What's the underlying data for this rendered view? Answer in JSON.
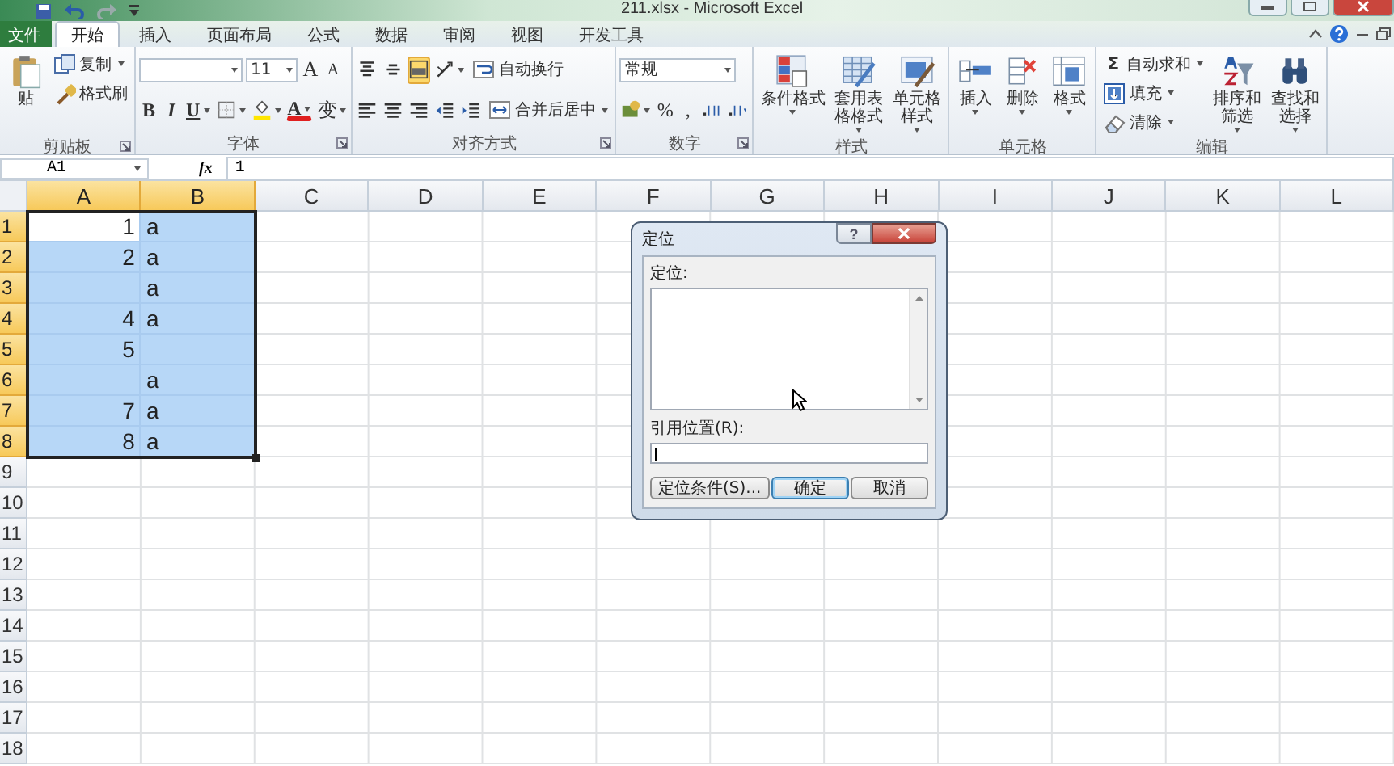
{
  "window": {
    "title": "211.xlsx - Microsoft Excel"
  },
  "tabs": [
    {
      "label": "文件",
      "kind": "file",
      "selected": false
    },
    {
      "label": "开始",
      "kind": "tab",
      "selected": true
    },
    {
      "label": "插入",
      "kind": "tab",
      "selected": false
    },
    {
      "label": "页面布局",
      "kind": "tab",
      "selected": false
    },
    {
      "label": "公式",
      "kind": "tab",
      "selected": false
    },
    {
      "label": "数据",
      "kind": "tab",
      "selected": false
    },
    {
      "label": "审阅",
      "kind": "tab",
      "selected": false
    },
    {
      "label": "视图",
      "kind": "tab",
      "selected": false
    },
    {
      "label": "开发工具",
      "kind": "tab",
      "selected": false
    }
  ],
  "ribbon": [
    {
      "label": "剪贴板",
      "launcher": true,
      "items": [
        {
          "kind": "large",
          "label": "贴",
          "dropdown": false
        },
        {
          "kind": "small",
          "label": "复制",
          "dropdown": true
        },
        {
          "kind": "small",
          "label": "格式刷",
          "dropdown": false
        }
      ]
    },
    {
      "label": "字体",
      "launcher": true,
      "items": [
        {
          "kind": "toolrow",
          "tools": [
            {
              "kind": "font-combo"
            },
            {
              "kind": "size-combo",
              "value": "11"
            },
            {
              "kind": "grow",
              "label": "A"
            },
            {
              "kind": "shrink",
              "label": "A"
            }
          ]
        },
        {
          "kind": "toolrow",
          "tools": [
            {
              "kind": "bold",
              "label": "B"
            },
            {
              "kind": "italic",
              "label": "I"
            },
            {
              "kind": "underline",
              "label": "U",
              "dropdown": true
            },
            {
              "kind": "icon",
              "dropdown": true,
              "selected": false
            },
            {
              "kind": "icon",
              "dropdown": true,
              "selected": false
            },
            {
              "kind": "font-color",
              "label": "A",
              "dropdown": true
            },
            {
              "kind": "text",
              "label": "变",
              "dropdown": true
            }
          ]
        }
      ]
    },
    {
      "label": "对齐方式",
      "launcher": true,
      "items": [
        {
          "kind": "toolrow",
          "tools": [
            {
              "kind": "icon",
              "selected": false
            },
            {
              "kind": "icon",
              "selected": false
            },
            {
              "kind": "icon",
              "selected": true
            },
            {
              "kind": "icon",
              "dropdown": true,
              "selected": false
            },
            {
              "kind": "small",
              "label": "自动换行",
              "dropdown": false
            }
          ]
        },
        {
          "kind": "toolrow",
          "tools": [
            {
              "kind": "icon",
              "selected": false
            },
            {
              "kind": "icon",
              "selected": false
            },
            {
              "kind": "icon",
              "selected": false
            },
            {
              "kind": "icon",
              "selected": false
            },
            {
              "kind": "icon",
              "selected": false
            },
            {
              "kind": "small",
              "label": "合并后居中",
              "dropdown": true
            }
          ]
        }
      ]
    },
    {
      "label": "数字",
      "launcher": true,
      "items": [
        {
          "kind": "toolrow",
          "tools": [
            {
              "kind": "format-combo",
              "value": "常规"
            }
          ]
        },
        {
          "kind": "toolrow",
          "tools": [
            {
              "kind": "icon",
              "dropdown": true,
              "selected": false
            },
            {
              "kind": "text",
              "label": "%"
            },
            {
              "kind": "text",
              "label": ","
            },
            {
              "kind": "icon",
              "selected": false
            },
            {
              "kind": "icon",
              "selected": false
            }
          ]
        }
      ]
    },
    {
      "label": "样式",
      "launcher": false,
      "items": [
        {
          "kind": "large",
          "label": "条件格式",
          "dropdown": true
        },
        {
          "kind": "large",
          "label": "套用表格格式",
          "dropdown": true
        },
        {
          "kind": "large",
          "label": "单元格样式",
          "dropdown": true
        }
      ]
    },
    {
      "label": "单元格",
      "launcher": false,
      "items": [
        {
          "kind": "large",
          "label": "插入",
          "dropdown": true
        },
        {
          "kind": "large",
          "label": "删除",
          "dropdown": true
        },
        {
          "kind": "large",
          "label": "格式",
          "dropdown": true
        }
      ]
    },
    {
      "label": "编辑",
      "launcher": false,
      "items": [
        {
          "kind": "small",
          "glyph": "Σ",
          "label": "自动求和",
          "dropdown": true
        },
        {
          "kind": "small",
          "label": "填充",
          "dropdown": true
        },
        {
          "kind": "small",
          "label": "清除",
          "dropdown": true
        },
        {
          "kind": "large",
          "label": "排序和筛选",
          "dropdown": true
        },
        {
          "kind": "large",
          "label": "查找和选择",
          "dropdown": true
        }
      ]
    }
  ],
  "formula_bar": {
    "name_box": "A1",
    "function_label": "fx",
    "formula": "1"
  },
  "sheet": {
    "columns": [
      {
        "label": "A",
        "selected": true
      },
      {
        "label": "B",
        "selected": true
      },
      {
        "label": "C",
        "selected": false
      },
      {
        "label": "D",
        "selected": false
      },
      {
        "label": "E",
        "selected": false
      },
      {
        "label": "F",
        "selected": false
      },
      {
        "label": "G",
        "selected": false
      },
      {
        "label": "H",
        "selected": false
      },
      {
        "label": "I",
        "selected": false
      },
      {
        "label": "J",
        "selected": false
      },
      {
        "label": "K",
        "selected": false
      },
      {
        "label": "L",
        "selected": false
      }
    ],
    "rows": [
      {
        "header": "1",
        "selected": true,
        "cells": [
          {
            "value": "1",
            "selected": true,
            "active": true
          },
          {
            "value": "a",
            "selected": true,
            "active": false
          }
        ]
      },
      {
        "header": "2",
        "selected": true,
        "cells": [
          {
            "value": "2",
            "selected": true,
            "active": false
          },
          {
            "value": "a",
            "selected": true,
            "active": false
          }
        ]
      },
      {
        "header": "3",
        "selected": true,
        "cells": [
          {
            "selected": true,
            "active": false
          },
          {
            "value": "a",
            "selected": true,
            "active": false
          }
        ]
      },
      {
        "header": "4",
        "selected": true,
        "cells": [
          {
            "value": "4",
            "selected": true,
            "active": false
          },
          {
            "value": "a",
            "selected": true,
            "active": false
          }
        ]
      },
      {
        "header": "5",
        "selected": true,
        "cells": [
          {
            "value": "5",
            "selected": true,
            "active": false
          },
          {
            "selected": true,
            "active": false
          }
        ]
      },
      {
        "header": "6",
        "selected": true,
        "cells": [
          {
            "selected": true,
            "active": false
          },
          {
            "value": "a",
            "selected": true,
            "active": false
          }
        ]
      },
      {
        "header": "7",
        "selected": true,
        "cells": [
          {
            "value": "7",
            "selected": true,
            "active": false
          },
          {
            "value": "a",
            "selected": true,
            "active": false
          }
        ]
      },
      {
        "header": "8",
        "selected": true,
        "cells": [
          {
            "value": "8",
            "selected": true,
            "active": false
          },
          {
            "value": "a",
            "selected": true,
            "active": false
          }
        ]
      },
      {
        "header": "9",
        "selected": false
      },
      {
        "header": "10",
        "selected": false
      },
      {
        "header": "11",
        "selected": false
      },
      {
        "header": "12",
        "selected": false
      },
      {
        "header": "13",
        "selected": false
      },
      {
        "header": "14",
        "selected": false
      },
      {
        "header": "15",
        "selected": false
      },
      {
        "header": "16",
        "selected": false
      },
      {
        "header": "17",
        "selected": false
      },
      {
        "header": "18",
        "selected": false
      }
    ]
  },
  "dialog": {
    "title": "定位",
    "help_glyph": "?",
    "list_label": "定位:",
    "reference_label": "引用位置(R):",
    "buttons": [
      {
        "label": "定位条件(S)...",
        "default": false
      },
      {
        "label": "确定",
        "default": true
      },
      {
        "label": "取消",
        "default": false
      }
    ]
  }
}
